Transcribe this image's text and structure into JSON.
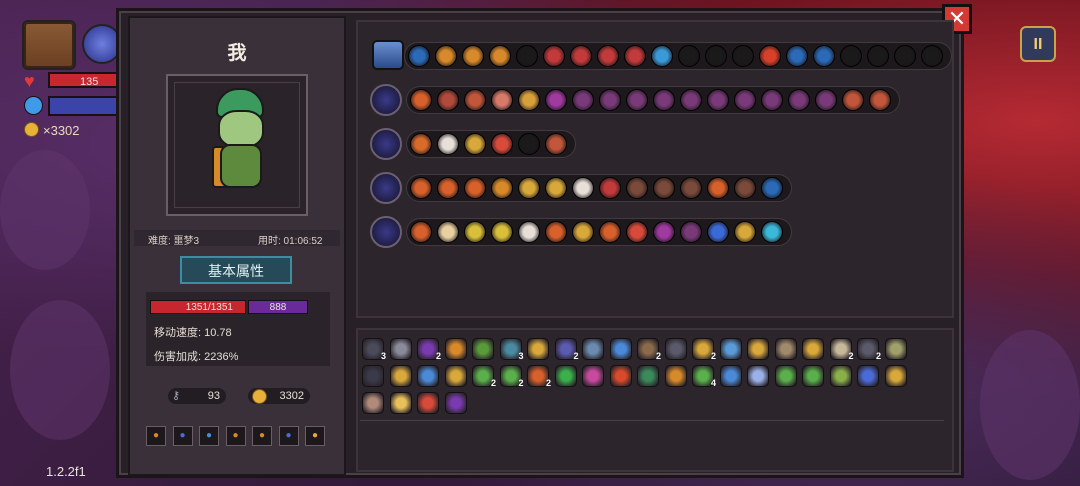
{
  "hud": {
    "hp_partial": "135",
    "gold": "×3302",
    "version": "1.2.2f1",
    "pause_label": "II",
    "icons": [
      "chest-icon",
      "orb-icon",
      "heart-icon",
      "mana-icon",
      "coin-icon"
    ]
  },
  "panel": {
    "close_label": "✕",
    "player_name": "我",
    "difficulty_label": "难度: 噩梦3",
    "time_label": "用时: 01:06:52",
    "section_title": "基本属性",
    "hp": "1351/1351",
    "mp": "888",
    "move_speed": "移动速度: 10.78",
    "damage_bonus": "伤害加成: 2236%",
    "keys": "93",
    "coins": "3302"
  },
  "weapon_rows": [
    {
      "slots": [
        "#2a6ab8",
        "#d88a2a",
        "#d88a2a",
        "#d88a2a",
        "#1a1a1a",
        "#c23a3a",
        "#c23a3a",
        "#c23a3a",
        "#c23a3a",
        "#3a9ad8",
        "#1a1a1a",
        "#1a1a1a",
        "#1a1a1a",
        "#d8402a",
        "#2a6ab8",
        "#2a6ab8",
        "#1a1a1a",
        "#1a1a1a",
        "#1a1a1a",
        "#1a1a1a"
      ]
    },
    {
      "slots": [
        "#d8602a",
        "#b04a3a",
        "#c2563a",
        "#d87a6a",
        "#d8a03a",
        "#a03aa0",
        "#7a3a7a",
        "#7a3a7a",
        "#7a3a7a",
        "#7a3a7a",
        "#7a3a7a",
        "#7a3a7a",
        "#7a3a7a",
        "#7a3a7a",
        "#7a3a7a",
        "#7a3a7a",
        "#c2563a",
        "#c2563a"
      ]
    },
    {
      "slots": [
        "#d86a2a",
        "#e8e0d8",
        "#d8a83a",
        "#d84a3a",
        "#1a1a1a",
        "#c2563a"
      ]
    },
    {
      "slots": [
        "#d8602a",
        "#d8602a",
        "#d8602a",
        "#d88a2a",
        "#d8a83a",
        "#d8a83a",
        "#e8e0d8",
        "#c23a3a",
        "#7a4a3a",
        "#7a4a3a",
        "#7a4a3a",
        "#d8602a",
        "#7a4a3a",
        "#2a6ab8"
      ]
    },
    {
      "slots": [
        "#d8602a",
        "#e8d0a0",
        "#d8c03a",
        "#d8c03a",
        "#e8e0d8",
        "#d8602a",
        "#d8a83a",
        "#d8602a",
        "#d84a3a",
        "#a03aa0",
        "#7a3a7a",
        "#3a6ad8",
        "#d8a83a",
        "#3ab8d8"
      ]
    }
  ],
  "items": [
    {
      "c": "#4a4a5a",
      "n": "3"
    },
    {
      "c": "#8a8a9a",
      "n": ""
    },
    {
      "c": "#7a3ab0",
      "n": "2"
    },
    {
      "c": "#d88a2a",
      "n": ""
    },
    {
      "c": "#5a9a3a",
      "n": ""
    },
    {
      "c": "#4a8aa0",
      "n": "3"
    },
    {
      "c": "#d8a83a",
      "n": ""
    },
    {
      "c": "#5a5ab0",
      "n": "2"
    },
    {
      "c": "#6a8ab0",
      "n": ""
    },
    {
      "c": "#4a8ad8",
      "n": ""
    },
    {
      "c": "#8a6a4a",
      "n": "2"
    },
    {
      "c": "#5a5a6a",
      "n": ""
    },
    {
      "c": "#d8a83a",
      "n": "2"
    },
    {
      "c": "#5a9ad8",
      "n": ""
    },
    {
      "c": "#d8a83a",
      "n": ""
    },
    {
      "c": "#a08a6a",
      "n": ""
    },
    {
      "c": "#d8a83a",
      "n": ""
    },
    {
      "c": "#c8b89a",
      "n": "2"
    },
    {
      "c": "#5a5a6a",
      "n": "2"
    },
    {
      "c": "#a0a06a",
      "n": ""
    },
    {
      "c": "#3a3a4a",
      "n": ""
    },
    {
      "c": "#d8a83a",
      "n": ""
    },
    {
      "c": "#4a8ad8",
      "n": ""
    },
    {
      "c": "#d8a83a",
      "n": ""
    },
    {
      "c": "#5ab04a",
      "n": "2"
    },
    {
      "c": "#5ab04a",
      "n": "2"
    },
    {
      "c": "#d8602a",
      "n": "2"
    },
    {
      "c": "#3ab04a",
      "n": ""
    },
    {
      "c": "#c84aa0",
      "n": ""
    },
    {
      "c": "#d84a2a",
      "n": ""
    },
    {
      "c": "#3a8a5a",
      "n": ""
    },
    {
      "c": "#d88a2a",
      "n": ""
    },
    {
      "c": "#5ab04a",
      "n": "4"
    },
    {
      "c": "#4a8ad8",
      "n": ""
    },
    {
      "c": "#9ab0e8",
      "n": ""
    },
    {
      "c": "#5ab04a",
      "n": ""
    },
    {
      "c": "#5ab04a",
      "n": ""
    },
    {
      "c": "#8ab04a",
      "n": ""
    },
    {
      "c": "#4a6ad8",
      "n": ""
    },
    {
      "c": "#d8a83a",
      "n": ""
    },
    {
      "c": "#b08a7a",
      "n": ""
    },
    {
      "c": "#e8c05a",
      "n": ""
    },
    {
      "c": "#d84a3a",
      "n": ""
    },
    {
      "c": "#7a3ab0",
      "n": ""
    }
  ],
  "potions": [
    "#d88a2a",
    "#4a6ad8",
    "#4a8ad8",
    "#d88a2a",
    "#d88a2a",
    "#4a6ad8",
    "#e8a83a"
  ]
}
